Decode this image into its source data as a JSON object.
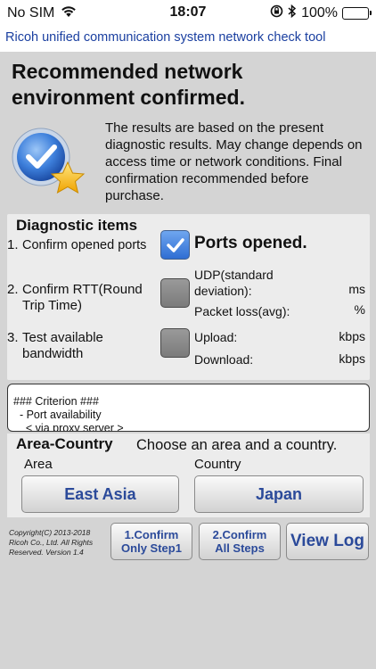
{
  "status_bar": {
    "carrier": "No SIM",
    "time": "18:07",
    "battery": "100%",
    "battery_level": 1.0
  },
  "app": {
    "title": "Ricoh unified communication system network check tool"
  },
  "result": {
    "headline": "Recommended network environment confirmed.",
    "description": "The results are based on the present diagnostic results. May change depends on access time or network conditions. Final confirmation recommended before purchase.",
    "icon": "checkmark-medal-with-star"
  },
  "diagnostics": {
    "title": "Diagnostic items",
    "items": [
      {
        "num": "1.",
        "label": "Confirm opened ports",
        "checked": true,
        "result": "Ports opened."
      },
      {
        "num": "2.",
        "label": "Confirm RTT(Round Trip Time)",
        "checked": false,
        "udp_label": "UDP(standard deviation):",
        "udp_unit": "ms",
        "loss_label": "Packet loss(avg):",
        "loss_unit": "%"
      },
      {
        "num": "3.",
        "label": "Test available bandwidth",
        "checked": false,
        "upload_label": "Upload:",
        "upload_unit": "kbps",
        "download_label": "Download:",
        "download_unit": "kbps"
      }
    ]
  },
  "criterion": {
    "text": "### Criterion ###\n  - Port availability\n    < via proxy server >"
  },
  "area_country": {
    "title": "Area-Country",
    "hint": "Choose an area and a country.",
    "area_label": "Area",
    "country_label": "Country",
    "area_value": "East Asia",
    "country_value": "Japan"
  },
  "footer": {
    "copyright": "Copyright(C) 2013-2018 Ricoh Co., Ltd. All Rights Reserved. Version 1.4",
    "btn_step1": "1.Confirm Only Step1",
    "btn_all": "2.Confirm All Steps",
    "btn_log": "View Log"
  },
  "colors": {
    "accent_text": "#2b4a9a",
    "title_blue": "#1a3fa0",
    "check_on": "#2f6ed3",
    "check_off": "#7b7b7b",
    "background": "#d4d4d4"
  }
}
